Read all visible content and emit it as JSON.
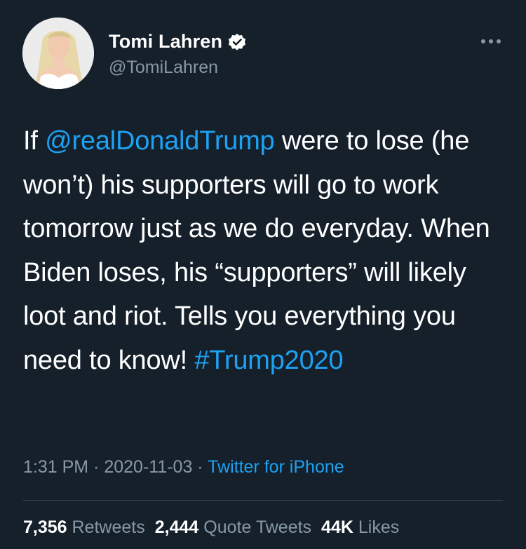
{
  "author": {
    "display_name": "Tomi Lahren",
    "handle": "@TomiLahren",
    "verified": true,
    "avatar_icon": "profile-photo"
  },
  "tweet": {
    "text_before_mention": "If ",
    "mention": "@realDonaldTrump",
    "text_after_mention": " were to lose (he won’t) his supporters will go to work tomorrow just as we do everyday. When Biden loses, his “supporters” will likely loot and riot. Tells you everything you need to know! ",
    "hashtag": "#Trump2020"
  },
  "meta": {
    "time": "1:31 PM",
    "separator": " · ",
    "date": "2020-11-03",
    "source": "Twitter for iPhone"
  },
  "stats": {
    "retweets_count": "7,356",
    "retweets_label": "Retweets",
    "quote_tweets_count": "2,444",
    "quote_tweets_label": "Quote Tweets",
    "likes_count": "44K",
    "likes_label": "Likes"
  },
  "colors": {
    "background": "#15202b",
    "accent": "#1da1f2",
    "secondary_text": "#8899a6",
    "divider": "#38444d"
  }
}
